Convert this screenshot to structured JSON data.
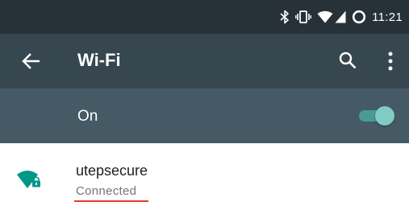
{
  "status_bar": {
    "time": "11:21",
    "icons": [
      "bluetooth-icon",
      "vibrate-icon",
      "wifi-signal-icon",
      "cell-signal-icon",
      "battery-saver-icon"
    ]
  },
  "app_bar": {
    "title": "Wi-Fi",
    "icons": [
      "back-arrow-icon",
      "search-icon",
      "more-vert-icon"
    ]
  },
  "wifi_toggle": {
    "label": "On",
    "state": "on"
  },
  "networks": [
    {
      "ssid": "utepsecure",
      "status": "Connected",
      "secured": true,
      "icon": "wifi-lock-icon"
    }
  ],
  "colors": {
    "status_bar": "#263238",
    "app_bar": "#37474f",
    "toggle_row": "#455a64",
    "accent": "#4db6ac",
    "wifi_icon": "#009688",
    "highlight_underline": "#e53935"
  }
}
